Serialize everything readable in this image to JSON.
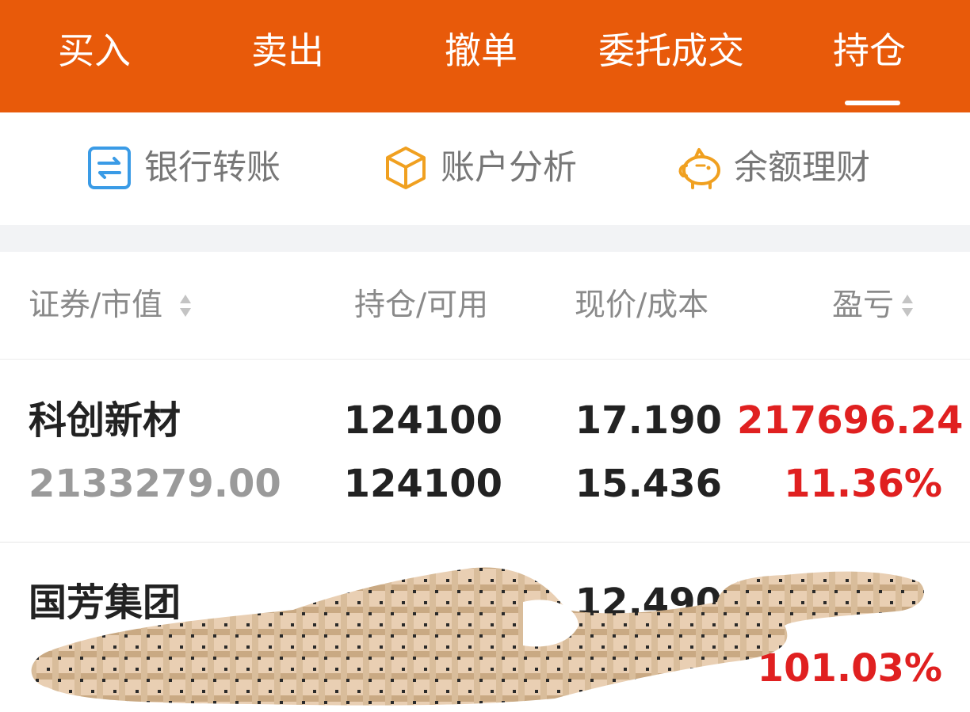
{
  "tabs": [
    {
      "label": "买入",
      "active": false
    },
    {
      "label": "卖出",
      "active": false
    },
    {
      "label": "撤单",
      "active": false
    },
    {
      "label": "委托成交",
      "active": false
    },
    {
      "label": "持仓",
      "active": true
    }
  ],
  "quick_actions": [
    {
      "label": "银行转账",
      "icon": "bank-transfer-icon"
    },
    {
      "label": "账户分析",
      "icon": "box-icon"
    },
    {
      "label": "余额理财",
      "icon": "piggy-bank-icon"
    }
  ],
  "table": {
    "headers": [
      "证券/市值",
      "持仓/可用",
      "现价/成本",
      "盈亏"
    ],
    "rows": [
      {
        "name": "科创新材",
        "market_value": "2133279.00",
        "position": "124100",
        "available": "124100",
        "price": "17.190",
        "cost": "15.436",
        "pnl": "217696.24",
        "pnl_pct": "11.36%"
      },
      {
        "name": "国芳集团",
        "price": "12.490",
        "pnl_pct": "101.03%"
      }
    ]
  },
  "colors": {
    "brand": "#e85a0a",
    "profit": "#e02020",
    "icon_blue": "#3a9be6",
    "icon_orange": "#f0a020"
  }
}
